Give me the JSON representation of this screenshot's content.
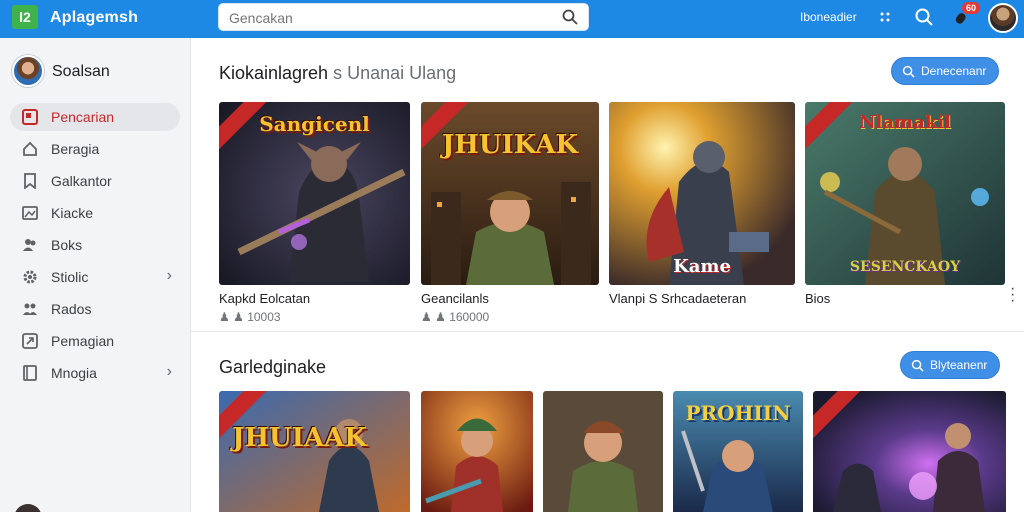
{
  "app": {
    "logo_text": "l2",
    "title": "Aplagemsh",
    "top_link": "Iboneadier",
    "notification_count": "60"
  },
  "search": {
    "placeholder": "Gencakan"
  },
  "sidebar": {
    "user_name": "Soalsan",
    "items": [
      {
        "label": "Pencarian",
        "icon": "search-icon",
        "active": true
      },
      {
        "label": "Beragia",
        "icon": "home-icon"
      },
      {
        "label": "Galkantor",
        "icon": "bookmark-icon"
      },
      {
        "label": "Kiacke",
        "icon": "image-icon"
      },
      {
        "label": "Boks",
        "icon": "people-icon"
      },
      {
        "label": "Stiolic",
        "icon": "gear-icon",
        "chevron": "›"
      },
      {
        "label": "Rados",
        "icon": "people-icon"
      },
      {
        "label": "Pemagian",
        "icon": "share-icon"
      },
      {
        "label": "Mnogia",
        "icon": "book-icon",
        "chevron": "›"
      }
    ]
  },
  "sections": [
    {
      "title": "Kiokainlagreh",
      "subtitle": "s Unanai Ulang",
      "button": "Denecenanr",
      "cards": [
        {
          "art": "Sangicenl",
          "title": "Kapkd Eolcatan",
          "meta": "10003"
        },
        {
          "art": "JHUIKAK",
          "title": "Geancilanls",
          "meta": "160000"
        },
        {
          "art": "Kame",
          "title": "Vlanpi S Srhcadaeteran",
          "meta": ""
        },
        {
          "art": "Nlamakil",
          "art2": "SESENCKAOY",
          "title": "Bios",
          "meta": ""
        }
      ]
    },
    {
      "title": "Garledginake",
      "subtitle": "",
      "button": "Blyteanenr",
      "cards": [
        {
          "art": "JHUIAAK"
        },
        {
          "art": ""
        },
        {
          "art": ""
        },
        {
          "art": "PROHIIN"
        },
        {
          "art": ""
        }
      ]
    }
  ],
  "colors": {
    "topbar": "#1e88e5",
    "accent_button": "#3f8fe6",
    "active_nav_text": "#c62828",
    "ribbon": "#c62828"
  }
}
